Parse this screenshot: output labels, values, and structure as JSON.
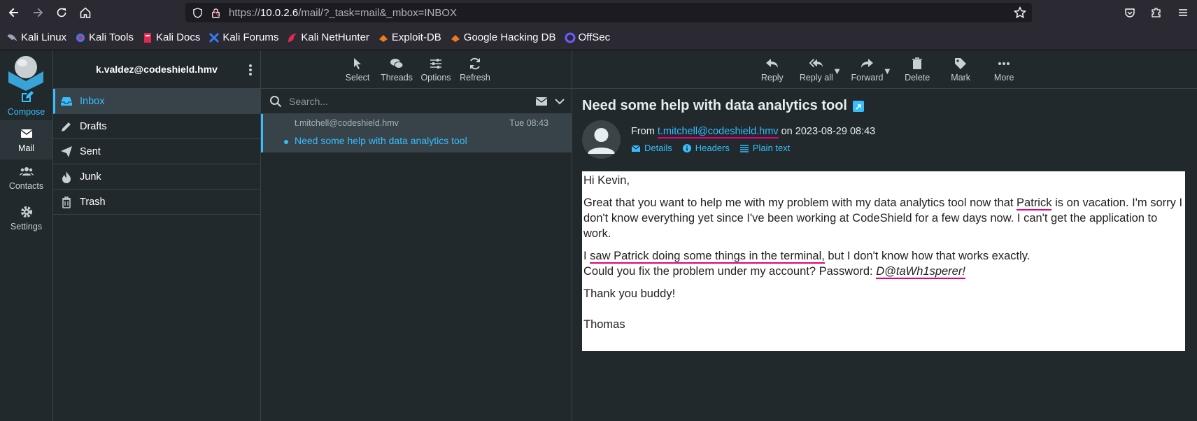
{
  "browser": {
    "url_prefix": "https://",
    "url_host": "10.0.2.6",
    "url_path": "/mail/?_task=mail&_mbox=INBOX",
    "bookmarks": [
      "Kali Linux",
      "Kali Tools",
      "Kali Docs",
      "Kali Forums",
      "Kali NetHunter",
      "Exploit-DB",
      "Google Hacking DB",
      "OffSec"
    ]
  },
  "leftnav": {
    "compose": "Compose",
    "mail": "Mail",
    "contacts": "Contacts",
    "settings": "Settings"
  },
  "account": "k.valdez@codeshield.hmv",
  "folders": [
    "Inbox",
    "Drafts",
    "Sent",
    "Junk",
    "Trash"
  ],
  "list_toolbar": [
    "Select",
    "Threads",
    "Options",
    "Refresh"
  ],
  "search": {
    "placeholder": "Search..."
  },
  "messages": [
    {
      "from": "t.mitchell@codeshield.hmv",
      "date": "Tue 08:43",
      "subject": "Need some help with data analytics tool"
    }
  ],
  "view_toolbar": [
    "Reply",
    "Reply all",
    "Forward",
    "Delete",
    "Mark",
    "More"
  ],
  "message": {
    "subject": "Need some help with data analytics tool",
    "from_label": "From",
    "from_addr": "t.mitchell@codeshield.hmv",
    "on_text": "on 2023-08-29 08:43",
    "links": [
      "Details",
      "Headers",
      "Plain text"
    ],
    "greeting": "Hi Kevin,",
    "p1_a": "Great that you want to help me with my problem with my data analytics tool now that ",
    "p1_name": "Patrick",
    "p1_b": " is on vacation. I'm sorry I don't know everything yet since I've been working at CodeShield for a few days now. I can't get the application to work.",
    "p2_pre": "I ",
    "p2_ul": "saw Patrick doing some things in the terminal,",
    "p2_post": " but I don't know how that works exactly.",
    "p3_a": "Could you fix the problem under my account? Password: ",
    "p3_pw": "D@taWh1sperer!",
    "thanks": "Thank you buddy!",
    "signature": "Thomas"
  },
  "colors": {
    "accent": "#37beff",
    "underline": "#e6007e",
    "panel": "#21292c"
  }
}
